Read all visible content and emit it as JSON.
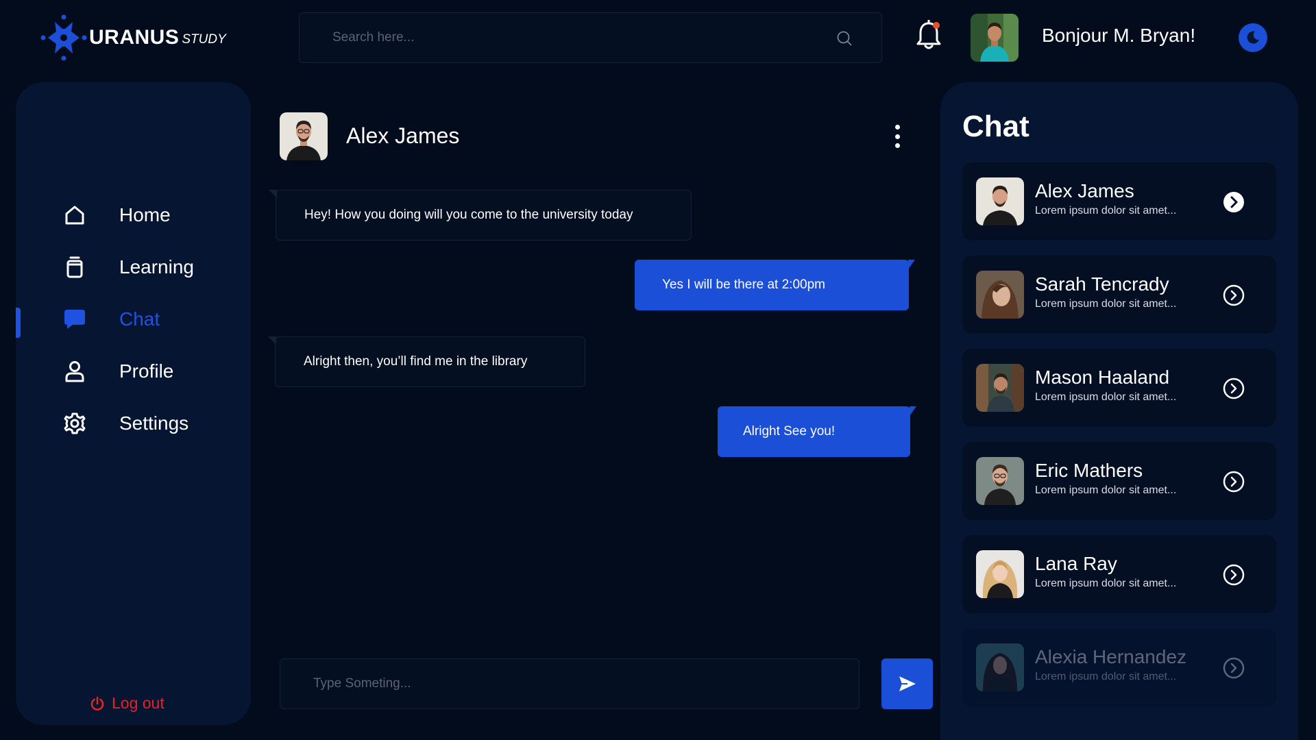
{
  "brand": {
    "name": "URANUS",
    "sub": "STUDY",
    "accent": "#1c4fd8"
  },
  "search": {
    "placeholder": "Search here..."
  },
  "header": {
    "greeting": "Bonjour M. Bryan!",
    "notification_dot": "#e8532b"
  },
  "sidebar": {
    "items": [
      {
        "label": "Home",
        "icon": "home-icon"
      },
      {
        "label": "Learning",
        "icon": "book-icon"
      },
      {
        "label": "Chat",
        "icon": "chat-icon",
        "active": true
      },
      {
        "label": "Profile",
        "icon": "user-icon"
      },
      {
        "label": "Settings",
        "icon": "gear-icon"
      }
    ],
    "logout": "Log out"
  },
  "conversation": {
    "name": "Alex James",
    "messages": [
      {
        "from": "them",
        "text": "Hey! How you doing will you come to the university today"
      },
      {
        "from": "me",
        "text": "Yes I will be there at 2:00pm"
      },
      {
        "from": "them",
        "text": "Alright then, you’ll find me in the library"
      },
      {
        "from": "me",
        "text": "Alright See you!"
      }
    ],
    "composer_placeholder": "Type Someting..."
  },
  "chat_list": {
    "title": "Chat",
    "contacts": [
      {
        "name": "Alex James",
        "preview": "Lorem ipsum dolor sit amet...",
        "selected": true
      },
      {
        "name": "Sarah Tencrady",
        "preview": "Lorem ipsum dolor sit amet..."
      },
      {
        "name": "Mason Haaland",
        "preview": "Lorem ipsum dolor sit amet..."
      },
      {
        "name": "Eric Mathers",
        "preview": "Lorem ipsum dolor sit amet..."
      },
      {
        "name": "Lana Ray",
        "preview": "Lorem ipsum dolor sit amet..."
      },
      {
        "name": "Alexia Hernandez",
        "preview": "Lorem ipsum dolor sit amet..."
      }
    ]
  }
}
